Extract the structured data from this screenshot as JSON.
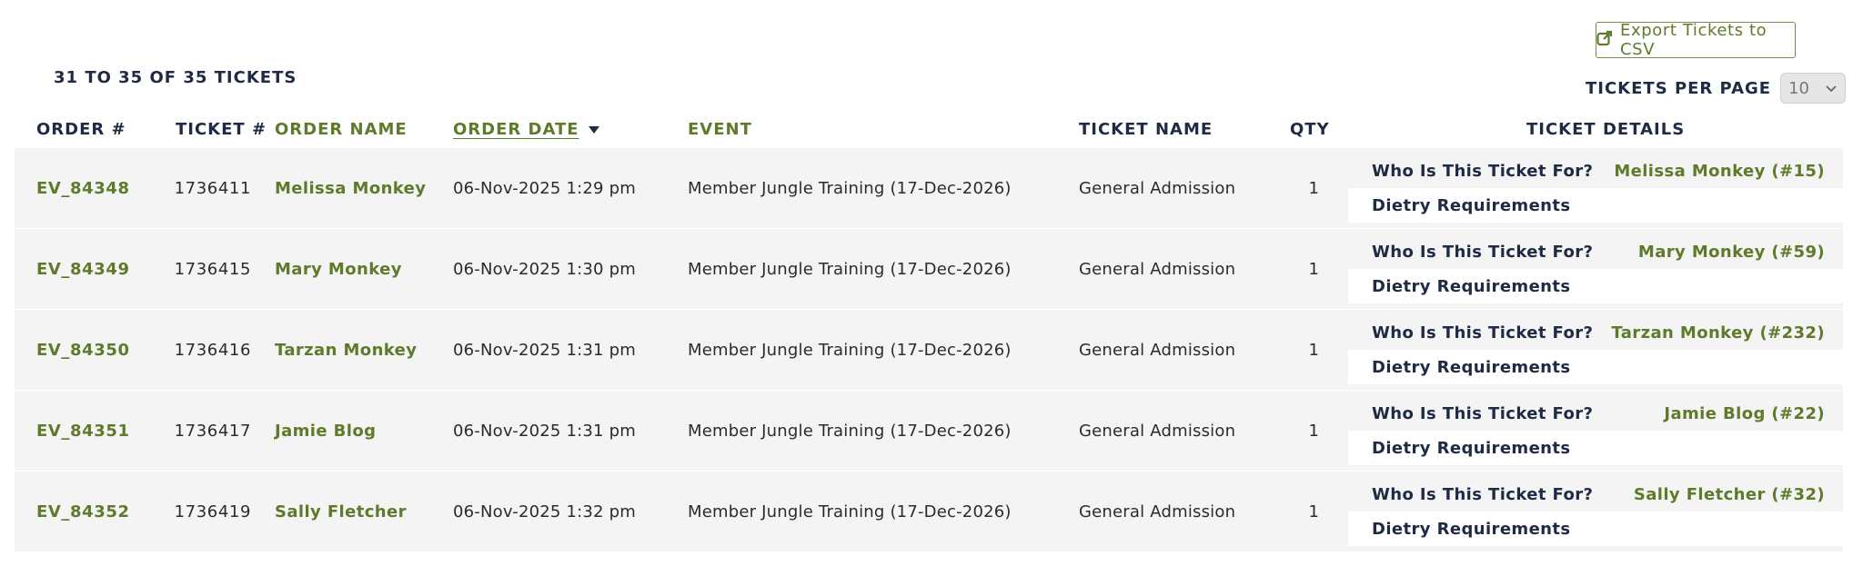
{
  "toolbar": {
    "export_label": "Export Tickets to CSV",
    "export_icon": "external-link-icon",
    "count_text": "31 TO 35 OF 35 TICKETS",
    "per_page_label": "TICKETS PER PAGE",
    "per_page_value": "10"
  },
  "columns": {
    "order": "ORDER #",
    "ticket": "TICKET #",
    "order_name": "ORDER NAME",
    "order_date": "ORDER DATE",
    "event": "EVENT",
    "ticket_name": "TICKET NAME",
    "qty": "QTY",
    "details": "TICKET DETAILS"
  },
  "rows": [
    {
      "order": "EV_84348",
      "ticket": "1736411",
      "name": "Melissa Monkey",
      "date": "06-Nov-2025 1:29 pm",
      "event": "Member Jungle Training (17-Dec-2026)",
      "ticket_name": "General Admission",
      "qty": "1",
      "who_label": "Who Is This Ticket For?",
      "who_value": "Melissa Monkey (#15)",
      "diet_label": "Dietry Requirements"
    },
    {
      "order": "EV_84349",
      "ticket": "1736415",
      "name": "Mary Monkey",
      "date": "06-Nov-2025 1:30 pm",
      "event": "Member Jungle Training (17-Dec-2026)",
      "ticket_name": "General Admission",
      "qty": "1",
      "who_label": "Who Is This Ticket For?",
      "who_value": "Mary Monkey (#59)",
      "diet_label": "Dietry Requirements"
    },
    {
      "order": "EV_84350",
      "ticket": "1736416",
      "name": "Tarzan Monkey",
      "date": "06-Nov-2025 1:31 pm",
      "event": "Member Jungle Training (17-Dec-2026)",
      "ticket_name": "General Admission",
      "qty": "1",
      "who_label": "Who Is This Ticket For?",
      "who_value": "Tarzan Monkey (#232)",
      "diet_label": "Dietry Requirements"
    },
    {
      "order": "EV_84351",
      "ticket": "1736417",
      "name": "Jamie Blog",
      "date": "06-Nov-2025 1:31 pm",
      "event": "Member Jungle Training (17-Dec-2026)",
      "ticket_name": "General Admission",
      "qty": "1",
      "who_label": "Who Is This Ticket For?",
      "who_value": "Jamie Blog (#22)",
      "diet_label": "Dietry Requirements"
    },
    {
      "order": "EV_84352",
      "ticket": "1736419",
      "name": "Sally Fletcher",
      "date": "06-Nov-2025 1:32 pm",
      "event": "Member Jungle Training (17-Dec-2026)",
      "ticket_name": "General Admission",
      "qty": "1",
      "who_label": "Who Is This Ticket For?",
      "who_value": "Sally Fletcher (#32)",
      "diet_label": "Dietry Requirements"
    }
  ]
}
